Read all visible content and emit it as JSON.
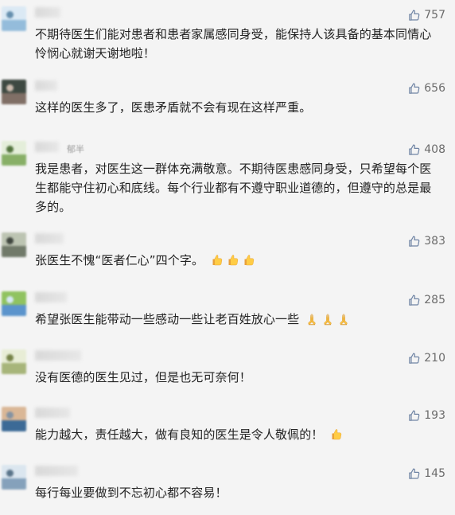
{
  "comments": [
    {
      "text": "不期待医生们能对患者和患者家属感同身受，能保持人该具备的基本同情心怜悯心就谢天谢地啦！",
      "likes": "757",
      "ghost_name": "",
      "emoji_type": "",
      "emoji_count": 0,
      "avatar_colors": [
        "#8cb8d9",
        "#d9e9f5",
        "#5a87a8"
      ]
    },
    {
      "text": "这样的医生多了，医患矛盾就不会有现在这样严重。",
      "likes": "656",
      "ghost_name": "",
      "emoji_type": "",
      "emoji_count": 0,
      "avatar_colors": [
        "#77645a",
        "#2f3b33",
        "#c9b7a9"
      ]
    },
    {
      "text": "我是患者，对医生这一群体充满敬意。不期待医患感同身受，只希望每个医生都能守住初心和底线。每个行业都有不遵守职业道德的，但遵守的总是最多的。",
      "likes": "408",
      "ghost_name": "郁半",
      "emoji_type": "",
      "emoji_count": 0,
      "avatar_colors": [
        "#7faa5c",
        "#e3eed8",
        "#466a2f"
      ]
    },
    {
      "text": "张医生不愧“医者仁心”四个字。",
      "likes": "383",
      "ghost_name": "",
      "emoji_type": "thumbs-up",
      "emoji_count": 3,
      "avatar_colors": [
        "#66705f",
        "#b8c0ad",
        "#313830"
      ]
    },
    {
      "text": "希望张医生能带动一些感动一些让老百姓放心一些",
      "likes": "285",
      "ghost_name": "",
      "emoji_type": "pray",
      "emoji_count": 3,
      "avatar_colors": [
        "#4f8cc9",
        "#88bf54",
        "#d3e7f7"
      ]
    },
    {
      "text": "没有医德的医生见过，但是也无可奈何！",
      "likes": "210",
      "ghost_name": "",
      "emoji_type": "",
      "emoji_count": 0,
      "avatar_colors": [
        "#a1b070",
        "#e7edd4",
        "#6c7a39"
      ]
    },
    {
      "text": "能力越大，责任越大，做有良知的医生是令人敬佩的！",
      "likes": "193",
      "ghost_name": "",
      "emoji_type": "thumbs-up",
      "emoji_count": 1,
      "avatar_colors": [
        "#2d5f8f",
        "#d8b28f",
        "#7b8b9c"
      ]
    },
    {
      "text": "每行每业要做到不忘初心都不容易！",
      "likes": "145",
      "ghost_name": "",
      "emoji_type": "",
      "emoji_count": 0,
      "avatar_colors": [
        "#7c9bb7",
        "#d9e5ef",
        "#4d6a81"
      ]
    }
  ]
}
